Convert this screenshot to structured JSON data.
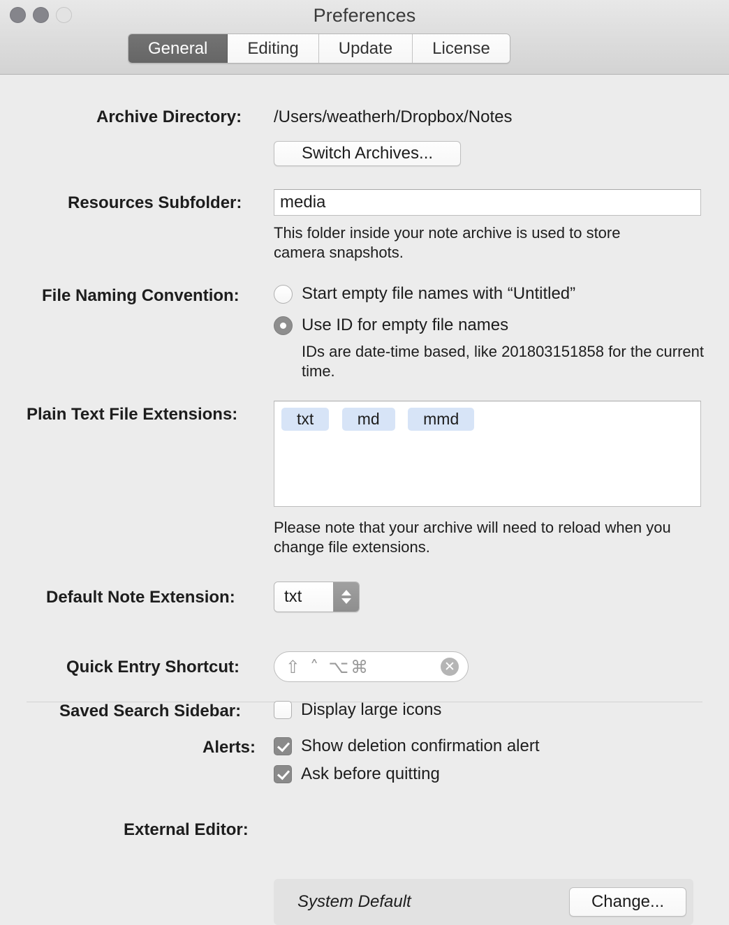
{
  "window": {
    "title": "Preferences",
    "traffic_lights": [
      "close-button",
      "minimize-button",
      "zoom-button"
    ]
  },
  "tabs": [
    {
      "label": "General",
      "selected": true
    },
    {
      "label": "Editing",
      "selected": false
    },
    {
      "label": "Update",
      "selected": false
    },
    {
      "label": "License",
      "selected": false
    }
  ],
  "general": {
    "archive_directory": {
      "label": "Archive Directory:",
      "path": "/Users/weatherh/Dropbox/Notes",
      "switch_button": "Switch Archives..."
    },
    "resources_subfolder": {
      "label": "Resources Subfolder:",
      "value": "media",
      "placeholder": "media",
      "help": "This folder inside your note archive is used to store camera snapshots."
    },
    "file_naming_convention": {
      "label": "File Naming Convention:",
      "options": [
        {
          "label": "Start empty file names with “Untitled”",
          "selected": false
        },
        {
          "label": "Use ID for empty file names",
          "selected": true
        }
      ],
      "help": "IDs are date-time based, like 201803151858 for the current time."
    },
    "plain_text_extensions": {
      "label": "Plain Text File Extensions:",
      "tokens": [
        "txt",
        "md",
        "mmd"
      ],
      "help": "Please note that your archive will need to reload when you change file extensions."
    },
    "default_note_extension": {
      "label": "Default Note Extension:",
      "value": "txt"
    },
    "quick_entry_shortcut": {
      "label": "Quick Entry Shortcut:",
      "glyphs": "⇧ ˄ ⌥⌘",
      "clear": "✕"
    },
    "saved_search_sidebar": {
      "label": "Saved Search Sidebar:",
      "checkbox": {
        "label": "Display large icons",
        "checked": false
      }
    },
    "alerts": {
      "label": "Alerts:",
      "checkboxes": [
        {
          "label": "Show deletion confirmation alert",
          "checked": true
        },
        {
          "label": "Ask before quitting",
          "checked": true
        }
      ]
    },
    "external_editor": {
      "label": "External Editor:",
      "value": "System Default",
      "change_button": "Change..."
    }
  },
  "colors": {
    "window_bg": "#ececec",
    "titlebar_bg": "#dcdcdc",
    "tab_selected_bg": "#6b6b6b",
    "token_bg": "#d7e4f7",
    "control_accent_inactive": "#8a8a8a"
  }
}
